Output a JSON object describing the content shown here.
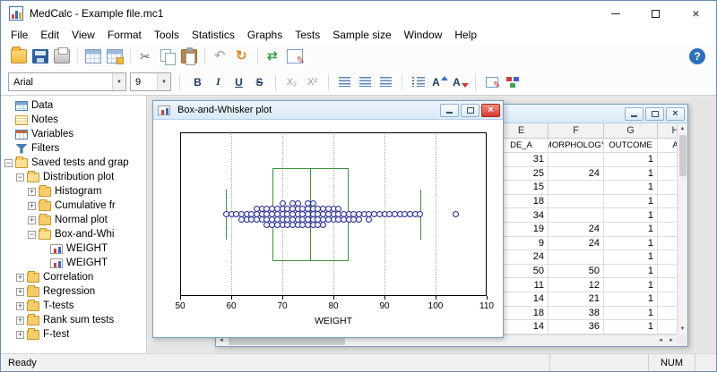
{
  "window": {
    "title": "MedCalc - Example file.mc1",
    "controls": [
      "minimize",
      "maximize",
      "close"
    ]
  },
  "menu": {
    "items": [
      "File",
      "Edit",
      "View",
      "Format",
      "Tools",
      "Statistics",
      "Graphs",
      "Tests",
      "Sample size",
      "Window",
      "Help"
    ]
  },
  "toolbar": {
    "groups": [
      [
        "open",
        "save",
        "print"
      ],
      [
        "table",
        "table-new"
      ],
      [
        "cut",
        "copy",
        "paste"
      ],
      [
        "undo",
        "redo"
      ],
      [
        "update",
        "edit"
      ]
    ],
    "help_label": "?"
  },
  "formatbar": {
    "font_name": "Arial",
    "font_size": "9",
    "buttons": [
      {
        "name": "bold",
        "label": "B"
      },
      {
        "name": "italic",
        "label": "I"
      },
      {
        "name": "underline",
        "label": "U"
      },
      {
        "name": "strikethrough",
        "label": "S"
      },
      {
        "name": "subscript",
        "label": "X₂",
        "sep": true
      },
      {
        "name": "superscript",
        "label": "X²"
      },
      {
        "name": "align-left",
        "sep": true
      },
      {
        "name": "align-center"
      },
      {
        "name": "align-right"
      },
      {
        "name": "list",
        "sep": true
      },
      {
        "name": "font-increase",
        "label": "A"
      },
      {
        "name": "font-decrease",
        "label": "A"
      },
      {
        "name": "cell-format",
        "sep": true
      },
      {
        "name": "colors"
      }
    ]
  },
  "sidebar": {
    "items": [
      {
        "label": "Data",
        "indent": 0,
        "expander": "none",
        "icon": "data"
      },
      {
        "label": "Notes",
        "indent": 0,
        "expander": "none",
        "icon": "notes"
      },
      {
        "label": "Variables",
        "indent": 0,
        "expander": "none",
        "icon": "variables"
      },
      {
        "label": "Filters",
        "indent": 0,
        "expander": "none",
        "icon": "filters"
      },
      {
        "label": "Saved tests and grap",
        "indent": 0,
        "expander": "minus",
        "icon": "folder-open"
      },
      {
        "label": "Distribution plot",
        "indent": 1,
        "expander": "minus",
        "icon": "folder-open"
      },
      {
        "label": "Histogram",
        "indent": 2,
        "expander": "plus",
        "icon": "folder"
      },
      {
        "label": "Cumulative fr",
        "indent": 2,
        "expander": "plus",
        "icon": "folder"
      },
      {
        "label": "Normal plot",
        "indent": 2,
        "expander": "plus",
        "icon": "folder"
      },
      {
        "label": "Box-and-Whi",
        "indent": 2,
        "expander": "minus",
        "icon": "folder-open"
      },
      {
        "label": "WEIGHT",
        "indent": 3,
        "expander": "none",
        "icon": "chart"
      },
      {
        "label": "WEIGHT",
        "indent": 3,
        "expander": "none",
        "icon": "chart"
      },
      {
        "label": "Correlation",
        "indent": 1,
        "expander": "plus",
        "icon": "folder"
      },
      {
        "label": "Regression",
        "indent": 1,
        "expander": "plus",
        "icon": "folder"
      },
      {
        "label": "T-tests",
        "indent": 1,
        "expander": "plus",
        "icon": "folder"
      },
      {
        "label": "Rank sum tests",
        "indent": 1,
        "expander": "plus",
        "icon": "folder"
      },
      {
        "label": "F-test",
        "indent": 1,
        "expander": "plus",
        "icon": "folder"
      }
    ]
  },
  "plot_window": {
    "title": "Box-and-Whisker plot"
  },
  "chart_data": {
    "type": "box-dot",
    "title": "Box-and-Whisker plot",
    "xlabel": "WEIGHT",
    "xlim": [
      50,
      110
    ],
    "xticks": [
      50,
      60,
      70,
      80,
      90,
      100,
      110
    ],
    "box": {
      "whisker_low": 59,
      "q1": 68,
      "median": 75.5,
      "q3": 83,
      "whisker_high": 97,
      "outliers": [
        104
      ]
    },
    "points": [
      59,
      60,
      61,
      62,
      62,
      63,
      63,
      64,
      64,
      65,
      65,
      65,
      66,
      66,
      66,
      67,
      67,
      67,
      67,
      68,
      68,
      68,
      68,
      69,
      69,
      69,
      69,
      70,
      70,
      70,
      70,
      70,
      71,
      71,
      71,
      71,
      72,
      72,
      72,
      72,
      72,
      73,
      73,
      73,
      73,
      73,
      74,
      74,
      74,
      74,
      75,
      75,
      75,
      75,
      75,
      76,
      76,
      76,
      76,
      76,
      77,
      77,
      77,
      77,
      78,
      78,
      78,
      78,
      79,
      79,
      79,
      80,
      80,
      80,
      81,
      81,
      81,
      82,
      82,
      83,
      83,
      84,
      84,
      85,
      85,
      86,
      87,
      87,
      88,
      89,
      90,
      91,
      92,
      93,
      94,
      95,
      96,
      97
    ]
  },
  "sheet": {
    "columns": [
      {
        "letter": "E",
        "name": "DE_A"
      },
      {
        "letter": "F",
        "name": "MORPHOLOGY"
      },
      {
        "letter": "G",
        "name": "OUTCOME"
      },
      {
        "letter": "H",
        "name": "A"
      }
    ],
    "rows": [
      [
        "31",
        "",
        "1",
        ""
      ],
      [
        "25",
        "24",
        "1",
        ""
      ],
      [
        "15",
        "",
        "1",
        ""
      ],
      [
        "18",
        "",
        "1",
        ""
      ],
      [
        "34",
        "",
        "1",
        ""
      ],
      [
        "19",
        "24",
        "1",
        ""
      ],
      [
        "9",
        "24",
        "1",
        ""
      ],
      [
        "24",
        "",
        "1",
        ""
      ],
      [
        "50",
        "50",
        "1",
        ""
      ],
      [
        "11",
        "12",
        "1",
        ""
      ],
      [
        "14",
        "21",
        "1",
        ""
      ],
      [
        "18",
        "38",
        "1",
        ""
      ],
      [
        "14",
        "36",
        "1",
        ""
      ]
    ]
  },
  "statusbar": {
    "left": "Ready",
    "num": "NUM"
  }
}
